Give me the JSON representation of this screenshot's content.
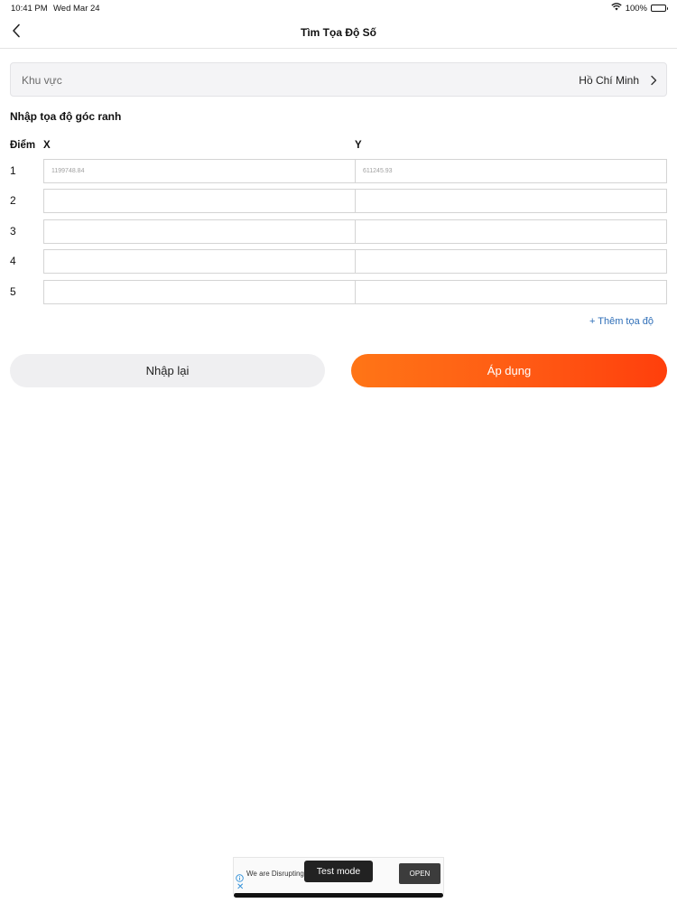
{
  "status_bar": {
    "time": "10:41 PM",
    "date": "Wed Mar 24",
    "battery": "100%",
    "battery_level": 1.0
  },
  "nav": {
    "title": "Tìm Tọa Độ Số",
    "back_icon": "chevron-left-icon"
  },
  "region": {
    "label": "Khu vực",
    "value": "Hồ Chí Minh",
    "chevron_icon": "chevron-right-icon"
  },
  "section_title": "Nhập tọa độ góc ranh",
  "columns": {
    "point": "Điểm",
    "x": "X",
    "y": "Y"
  },
  "rows": [
    {
      "num": "1",
      "x_placeholder": "1199748.84",
      "y_placeholder": "611245.93",
      "x_value": "",
      "y_value": ""
    },
    {
      "num": "2",
      "x_placeholder": "",
      "y_placeholder": "",
      "x_value": "",
      "y_value": ""
    },
    {
      "num": "3",
      "x_placeholder": "",
      "y_placeholder": "",
      "x_value": "",
      "y_value": ""
    },
    {
      "num": "4",
      "x_placeholder": "",
      "y_placeholder": "",
      "x_value": "",
      "y_value": ""
    },
    {
      "num": "5",
      "x_placeholder": "",
      "y_placeholder": "",
      "x_value": "",
      "y_value": ""
    }
  ],
  "add_coordinate": "+ Thêm tọa độ",
  "buttons": {
    "reset": "Nhập lại",
    "apply": "Áp dụng"
  },
  "colors": {
    "accent_orange": "#ff5a14",
    "link_blue": "#2f6fb8",
    "reset_bg": "#efeff1"
  },
  "ad": {
    "text": "We are Disrupting",
    "test_mode": "Test mode",
    "open": "OPEN",
    "close_icon": "close-icon",
    "info_icon": "info-icon"
  }
}
